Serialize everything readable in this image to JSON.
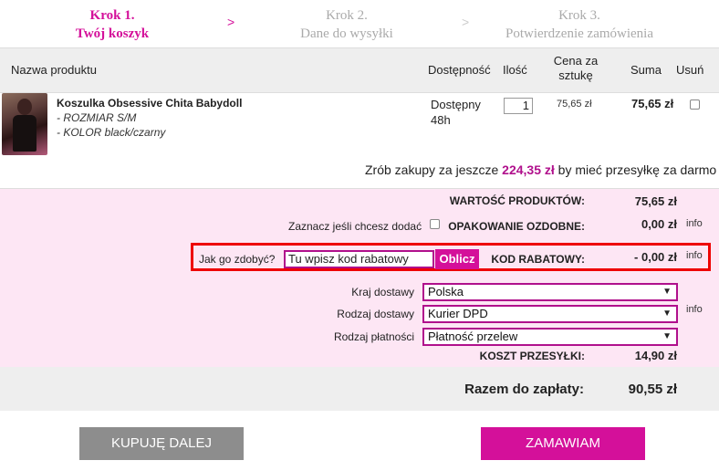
{
  "steps": [
    {
      "line1": "Krok 1.",
      "line2": "Twój koszyk"
    },
    {
      "line1": "Krok 2.",
      "line2": "Dane do wysyłki"
    },
    {
      "line1": "Krok 3.",
      "line2": "Potwierdzenie zamówienia"
    }
  ],
  "step_arrow": ">",
  "table_header": {
    "name": "Nazwa produktu",
    "availability": "Dostępność",
    "quantity": "Ilość",
    "unit_price": "Cena za sztukę",
    "sum": "Suma",
    "remove": "Usuń"
  },
  "product": {
    "name": "Koszulka Obsessive Chita Babydoll",
    "options": [
      "- ROZMIAR S/M",
      "- KOLOR black/czarny"
    ],
    "availability": "Dostępny 48h",
    "quantity": "1",
    "unit_price": "75,65 zł",
    "sum": "75,65 zł"
  },
  "free_shipping": {
    "before": "Zrób zakupy za jeszcze ",
    "amount": "224,35 zł",
    "after": " by mieć przesyłkę za darmo"
  },
  "summary": {
    "products_value_label": "WARTOŚĆ PRODUKTÓW:",
    "products_value": "75,65 zł",
    "gift_wrap_prompt": "Zaznacz jeśli chcesz dodać",
    "gift_wrap_label": "OPAKOWANIE OZDOBNE:",
    "gift_wrap_value": "0,00 zł",
    "info": "info",
    "coupon_question": "Jak go zdobyć?",
    "coupon_placeholder": "Tu wpisz kod rabatowy",
    "coupon_button": "Oblicz",
    "coupon_label": "KOD RABATOWY:",
    "coupon_value": "- 0,00 zł",
    "country_label": "Kraj dostawy",
    "country_value": "Polska",
    "delivery_label": "Rodzaj dostawy",
    "delivery_value": "Kurier DPD",
    "payment_label": "Rodzaj płatności",
    "payment_value": "Płatność przelew",
    "shipping_cost_label": "KOSZT PRZESYŁKI:",
    "shipping_cost_value": "14,90 zł"
  },
  "total": {
    "label": "Razem do zapłaty:",
    "value": "90,55 zł"
  },
  "buttons": {
    "continue": "KUPUJĘ DALEJ",
    "order": "ZAMAWIAM"
  },
  "colors": {
    "accent": "#d4109a",
    "pink_bg": "#fde6f4",
    "highlight_border": "#e00000",
    "grey_button": "#8d8d8d"
  }
}
